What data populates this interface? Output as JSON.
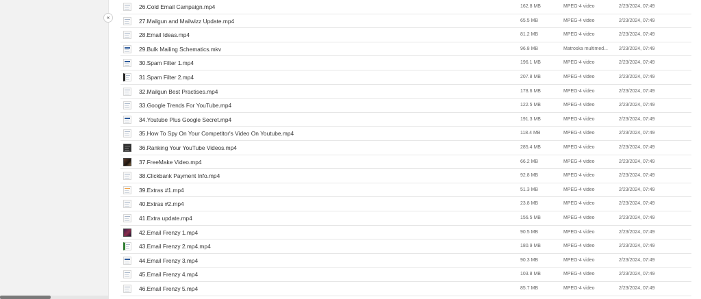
{
  "sidebar": {
    "collapse_label": "«"
  },
  "files": [
    {
      "name": "26.Cold Email Campaign.mp4",
      "size": "162.8 MB",
      "type": "MPEG-4 video",
      "modified": "2/23/2024, 07:49",
      "thumb": "doc"
    },
    {
      "name": "27.Mailgun and Mailwizz Update.mp4",
      "size": "65.5 MB",
      "type": "MPEG-4 video",
      "modified": "2/23/2024, 07:49",
      "thumb": "doc"
    },
    {
      "name": "28.Email Ideas.mp4",
      "size": "81.2 MB",
      "type": "MPEG-4 video",
      "modified": "2/23/2024, 07:49",
      "thumb": "doc"
    },
    {
      "name": "29.Bulk Mailing Schematics.mkv",
      "size": "96.8 MB",
      "type": "Matroska multimed...",
      "modified": "2/23/2024, 07:49",
      "thumb": "blue"
    },
    {
      "name": "30.Spam Filter 1.mp4",
      "size": "196.1 MB",
      "type": "MPEG-4 video",
      "modified": "2/23/2024, 07:49",
      "thumb": "blue"
    },
    {
      "name": "31.Spam Filter 2.mp4",
      "size": "207.8 MB",
      "type": "MPEG-4 video",
      "modified": "2/23/2024, 07:49",
      "thumb": "side-dark"
    },
    {
      "name": "32.Mailgun Best Practises.mp4",
      "size": "178.6 MB",
      "type": "MPEG-4 video",
      "modified": "2/23/2024, 07:49",
      "thumb": "doc"
    },
    {
      "name": "33.Google Trends For YouTube.mp4",
      "size": "122.5 MB",
      "type": "MPEG-4 video",
      "modified": "2/23/2024, 07:49",
      "thumb": "doc"
    },
    {
      "name": "34.Youtube Plus Google Secret.mp4",
      "size": "191.3 MB",
      "type": "MPEG-4 video",
      "modified": "2/23/2024, 07:49",
      "thumb": "blue"
    },
    {
      "name": "35.How To Spy On Your Competitor's Video On Youtube.mp4",
      "size": "118.4 MB",
      "type": "MPEG-4 video",
      "modified": "2/23/2024, 07:49",
      "thumb": "doc"
    },
    {
      "name": "36.Ranking Your YouTube Videos.mp4",
      "size": "285.4 MB",
      "type": "MPEG-4 video",
      "modified": "2/23/2024, 07:49",
      "thumb": "dark"
    },
    {
      "name": "37.FreeMake Video.mp4",
      "size": "66.2 MB",
      "type": "MPEG-4 video",
      "modified": "2/23/2024, 07:49",
      "thumb": "photo"
    },
    {
      "name": "38.Clickbank Payment Info.mp4",
      "size": "92.8 MB",
      "type": "MPEG-4 video",
      "modified": "2/23/2024, 07:49",
      "thumb": "doc"
    },
    {
      "name": "39.Extras #1.mp4",
      "size": "51.3 MB",
      "type": "MPEG-4 video",
      "modified": "2/23/2024, 07:49",
      "thumb": "orange"
    },
    {
      "name": "40.Extras #2.mp4",
      "size": "23.8 MB",
      "type": "MPEG-4 video",
      "modified": "2/23/2024, 07:49",
      "thumb": "doc"
    },
    {
      "name": "41.Extra update.mp4",
      "size": "156.5 MB",
      "type": "MPEG-4 video",
      "modified": "2/23/2024, 07:49",
      "thumb": "doc"
    },
    {
      "name": "42.Email Frenzy 1.mp4",
      "size": "90.5 MB",
      "type": "MPEG-4 video",
      "modified": "2/23/2024, 07:49",
      "thumb": "purple"
    },
    {
      "name": "43.Email Frenzy 2.mp4.mp4",
      "size": "180.9 MB",
      "type": "MPEG-4 video",
      "modified": "2/23/2024, 07:49",
      "thumb": "side-green"
    },
    {
      "name": "44.Email Frenzy 3.mp4",
      "size": "90.3 MB",
      "type": "MPEG-4 video",
      "modified": "2/23/2024, 07:49",
      "thumb": "blue"
    },
    {
      "name": "45.Email Frenzy 4.mp4",
      "size": "103.8 MB",
      "type": "MPEG-4 video",
      "modified": "2/23/2024, 07:49",
      "thumb": "doc"
    },
    {
      "name": "46.Email Frenzy 5.mp4",
      "size": "85.7 MB",
      "type": "MPEG-4 video",
      "modified": "2/23/2024, 07:49",
      "thumb": "doc"
    }
  ]
}
